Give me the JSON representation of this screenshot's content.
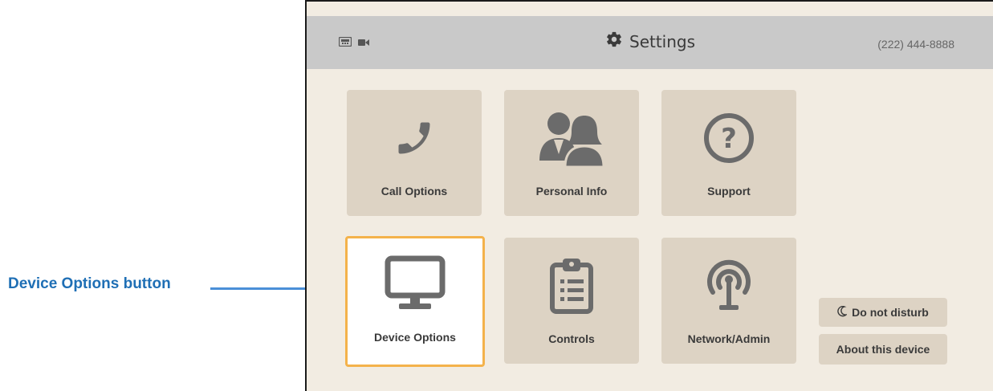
{
  "callout": {
    "label": "Device Options button"
  },
  "header": {
    "title": "Settings",
    "phone": "(222) 444-8888",
    "status_icons": [
      "network-icon",
      "camera-icon"
    ]
  },
  "tiles": [
    {
      "label": "Call Options",
      "icon": "phone-icon"
    },
    {
      "label": "Personal Info",
      "icon": "people-icon"
    },
    {
      "label": "Support",
      "icon": "question-icon"
    },
    {
      "label": "Device Options",
      "icon": "monitor-icon",
      "selected": true
    },
    {
      "label": "Controls",
      "icon": "clipboard-icon"
    },
    {
      "label": "Network/Admin",
      "icon": "broadcast-icon"
    }
  ],
  "side_buttons": {
    "dnd": "Do not disturb",
    "about": "About this device"
  },
  "colors": {
    "accent": "#f4b24b",
    "callout": "#1f6fb5",
    "tile": "#ddd3c4",
    "background": "#f2ece2",
    "header": "#c9c9c9"
  }
}
